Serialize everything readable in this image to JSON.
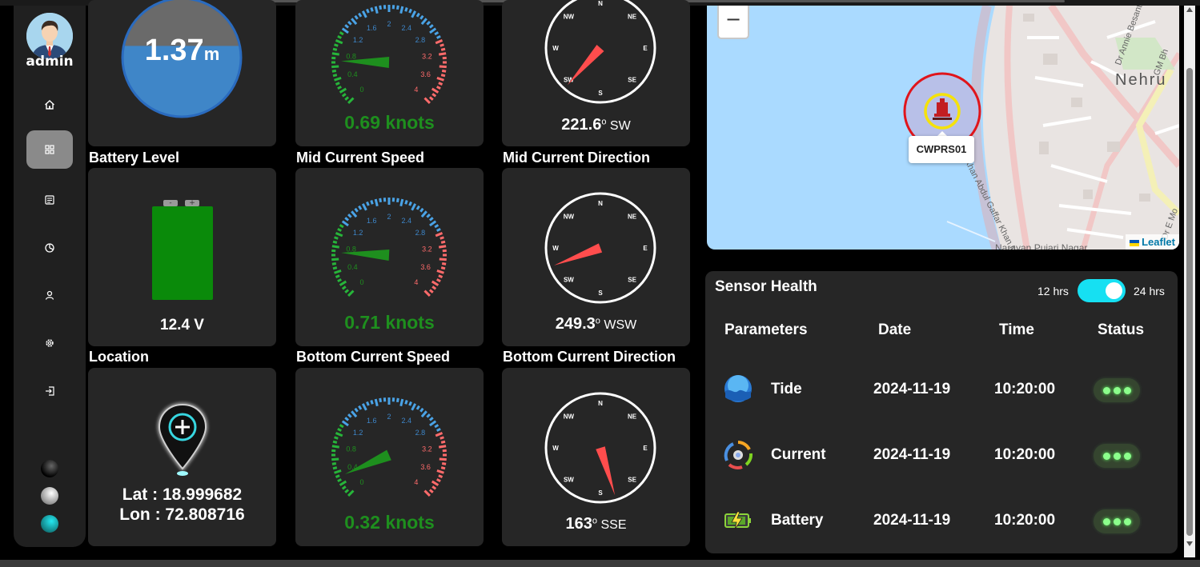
{
  "user": {
    "name": "admin"
  },
  "nav": [
    "home-icon",
    "dashboard-icon",
    "report-icon",
    "history-icon",
    "user-icon",
    "settings-icon",
    "logout-icon"
  ],
  "themes": [
    "dark",
    "light",
    "teal"
  ],
  "tide": {
    "value": "1.37",
    "unit": "m",
    "fill_fraction": 0.6
  },
  "cards": {
    "battery": {
      "title": "Battery Level",
      "value": "12.4 V",
      "terminal_minus": "-",
      "terminal_plus": "+"
    },
    "mid_speed": {
      "title": "Mid Current Speed",
      "value": "0.71 knots",
      "needle_knots": 0.71
    },
    "mid_direction": {
      "title": "Mid Current Direction",
      "degrees": "249.3",
      "deg_sign": "o",
      "cardinal": "WSW",
      "angle": 249.3
    },
    "location": {
      "title": "Location",
      "lat": "Lat : 18.999682",
      "lon": "Lon : 72.808716"
    },
    "bottom_speed": {
      "title": "Bottom Current Speed",
      "value": "0.32 knots",
      "needle_knots": 0.32
    },
    "bottom_direction": {
      "title": "Bottom Current Direction",
      "degrees": "163",
      "deg_sign": "o",
      "cardinal": "SSE",
      "angle": 163
    },
    "top_speed": {
      "value": "0.69 knots",
      "needle_knots": 0.69
    },
    "top_direction": {
      "degrees": "221.6",
      "deg_sign": "o",
      "cardinal": "SW",
      "angle": 221.6
    }
  },
  "gauge": {
    "ticks": [
      "0",
      "0.4",
      "0.8",
      "1.2",
      "1.6",
      "2",
      "2.4",
      "2.8",
      "3.2",
      "3.6",
      "4"
    ]
  },
  "compass": {
    "labels": [
      "N",
      "NE",
      "E",
      "SE",
      "S",
      "SW",
      "W",
      "NW"
    ]
  },
  "map": {
    "zoom_out": "−",
    "marker_label": "CWPRS01",
    "attribution": "Leaflet",
    "labels": {
      "area1": "Nehru",
      "road1": "Khan Abdul Gaffar Khan Marg",
      "area2": "Narayan Pujari Nagar",
      "road2": "Dr Annie Besant",
      "area3": "GM Bh",
      "area4": "Dr E Mo"
    }
  },
  "sensor_health": {
    "title": "Sensor Health",
    "toggle_left": "12 hrs",
    "toggle_right": "24 hrs",
    "headers": [
      "Parameters",
      "Date",
      "Time",
      "Status"
    ],
    "rows": [
      {
        "name": "Tide",
        "date": "2024-11-19",
        "time": "10:20:00",
        "icon": "tide-icon"
      },
      {
        "name": "Current",
        "date": "2024-11-19",
        "time": "10:20:00",
        "icon": "current-icon"
      },
      {
        "name": "Battery",
        "date": "2024-11-19",
        "time": "10:20:00",
        "icon": "battery-charging-icon"
      }
    ]
  },
  "colors": {
    "accent": "#16e0f2",
    "green": "#1e8f1e",
    "needle": "#ff4d4d",
    "card": "#262626",
    "water": "#aadaff"
  }
}
